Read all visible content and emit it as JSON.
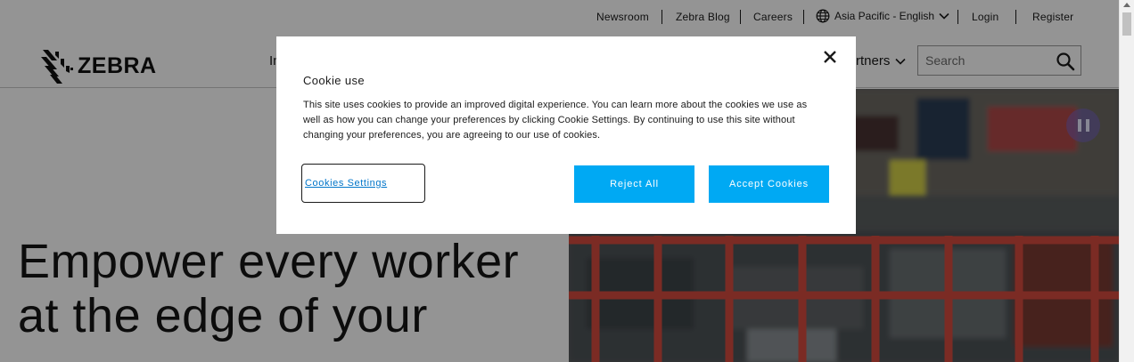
{
  "header": {
    "utility_links": [
      "Newsroom",
      "Zebra Blog",
      "Careers"
    ],
    "region": {
      "label": "Asia Pacific - English",
      "icon": "globe-icon"
    },
    "login": "Login",
    "register": "Register",
    "logo_text": "ZEBRA",
    "nav_fragment_left": "In",
    "nav_fragment_right": "rtners",
    "search": {
      "placeholder": "Search",
      "value": ""
    }
  },
  "hero": {
    "headline": "Empower every worker at the edge of your"
  },
  "cookie_modal": {
    "title": "Cookie use",
    "body": "This site uses cookies to provide an improved digital experience. You can learn more about the cookies we use as well as how you can change your preferences by clicking Cookie Settings. By continuing to use this site without changing your preferences, you are agreeing to our use of cookies.",
    "settings_label": "Cookies Settings",
    "reject_label": "Reject All",
    "accept_label": "Accept Cookies",
    "close_icon": "close-icon"
  },
  "colors": {
    "accent": "#00a9f3",
    "link": "#0075c9",
    "overlay": "rgba(0,0,0,0.42)",
    "pause_button": "#7864c8"
  }
}
